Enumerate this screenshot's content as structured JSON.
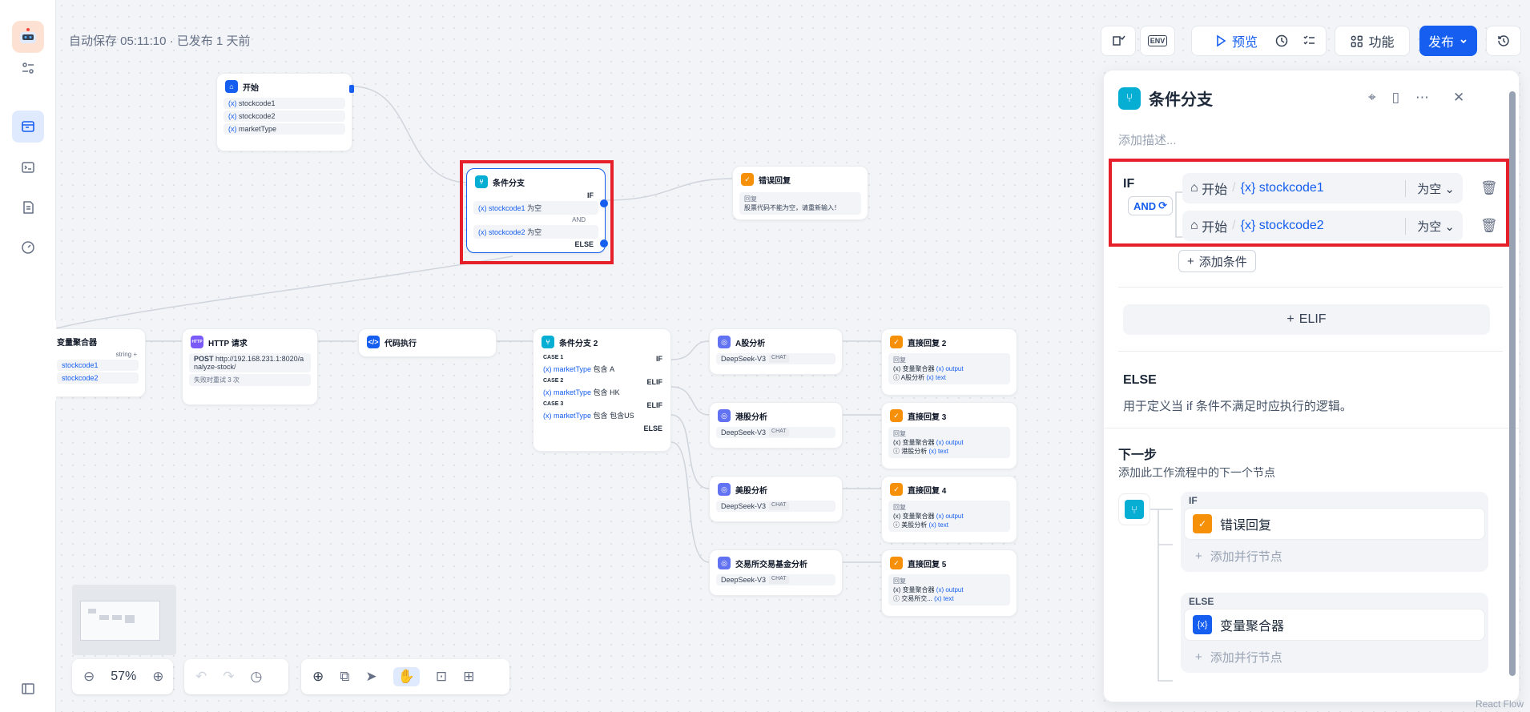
{
  "topbar": {
    "autosave": "自动保存 05:11:10 · 已发布 1 天前",
    "preview": "预览",
    "features": "功能",
    "publish": "发布",
    "env": "ENV"
  },
  "nodes": {
    "start": {
      "title": "开始",
      "vars": [
        "stockcode1",
        "stockcode2",
        "marketType"
      ]
    },
    "branch1": {
      "title": "条件分支",
      "if": "IF",
      "else": "ELSE",
      "and": "AND",
      "conds": [
        {
          "var": "stockcode1",
          "op": "为空"
        },
        {
          "var": "stockcode2",
          "op": "为空"
        }
      ]
    },
    "error_reply": {
      "title": "错误回复",
      "label": "回复",
      "text": "股票代码不能为空，请重新输入！"
    },
    "aggregator": {
      "title": "变量聚合器",
      "type": "string",
      "vars": [
        "stockcode1",
        "stockcode2"
      ]
    },
    "http": {
      "title": "HTTP 请求",
      "method": "POST",
      "url": "http://192.168.231.1:8020/analyze-stock/",
      "retry": "失败时重试 3 次"
    },
    "code": {
      "title": "代码执行"
    },
    "branch2": {
      "title": "条件分支 2",
      "cases": [
        {
          "case": "CASE 1",
          "kind": "IF",
          "var": "marketType",
          "op": "包含",
          "val": "A"
        },
        {
          "case": "CASE 2",
          "kind": "ELIF",
          "var": "marketType",
          "op": "包含",
          "val": "HK"
        },
        {
          "case": "CASE 3",
          "kind": "ELIF",
          "var": "marketType",
          "op": "包含",
          "val": "包含US"
        }
      ],
      "else": "ELSE"
    },
    "llms": [
      {
        "title": "A股分析",
        "model": "DeepSeek-V3",
        "chip": "CHAT"
      },
      {
        "title": "港股分析",
        "model": "DeepSeek-V3",
        "chip": "CHAT"
      },
      {
        "title": "美股分析",
        "model": "DeepSeek-V3",
        "chip": "CHAT"
      },
      {
        "title": "交易所交易基金分析",
        "model": "DeepSeek-V3",
        "chip": "CHAT"
      }
    ],
    "replies": [
      {
        "title": "直接回复 2",
        "label": "回复",
        "l1": "变量聚合器",
        "l1v": "output",
        "l2": "A股分析",
        "l2v": "text"
      },
      {
        "title": "直接回复 3",
        "label": "回复",
        "l1": "变量聚合器",
        "l1v": "output",
        "l2": "港股分析",
        "l2v": "text"
      },
      {
        "title": "直接回复 4",
        "label": "回复",
        "l1": "变量聚合器",
        "l1v": "output",
        "l2": "美股分析",
        "l2v": "text"
      },
      {
        "title": "直接回复 5",
        "label": "回复",
        "l1": "变量聚合器",
        "l1v": "output",
        "l2": "交易所交...",
        "l2v": "text"
      }
    ]
  },
  "panel": {
    "title": "条件分支",
    "desc_placeholder": "添加描述...",
    "if_label": "IF",
    "and_label": "AND",
    "conditions": [
      {
        "node": "开始",
        "var": "stockcode1",
        "op": "为空"
      },
      {
        "node": "开始",
        "var": "stockcode2",
        "op": "为空"
      }
    ],
    "add_condition": "添加条件",
    "elif_btn": "ELIF",
    "else_title": "ELSE",
    "else_desc": "用于定义当 if 条件不满足时应执行的逻辑。",
    "next_title": "下一步",
    "next_desc": "添加此工作流程中的下一个节点",
    "next_if": "IF",
    "next_if_node": "错误回复",
    "add_parallel": "添加并行节点",
    "next_else": "ELSE",
    "next_else_node": "变量聚合器"
  },
  "zoom": "57%",
  "watermark": "React Flow"
}
